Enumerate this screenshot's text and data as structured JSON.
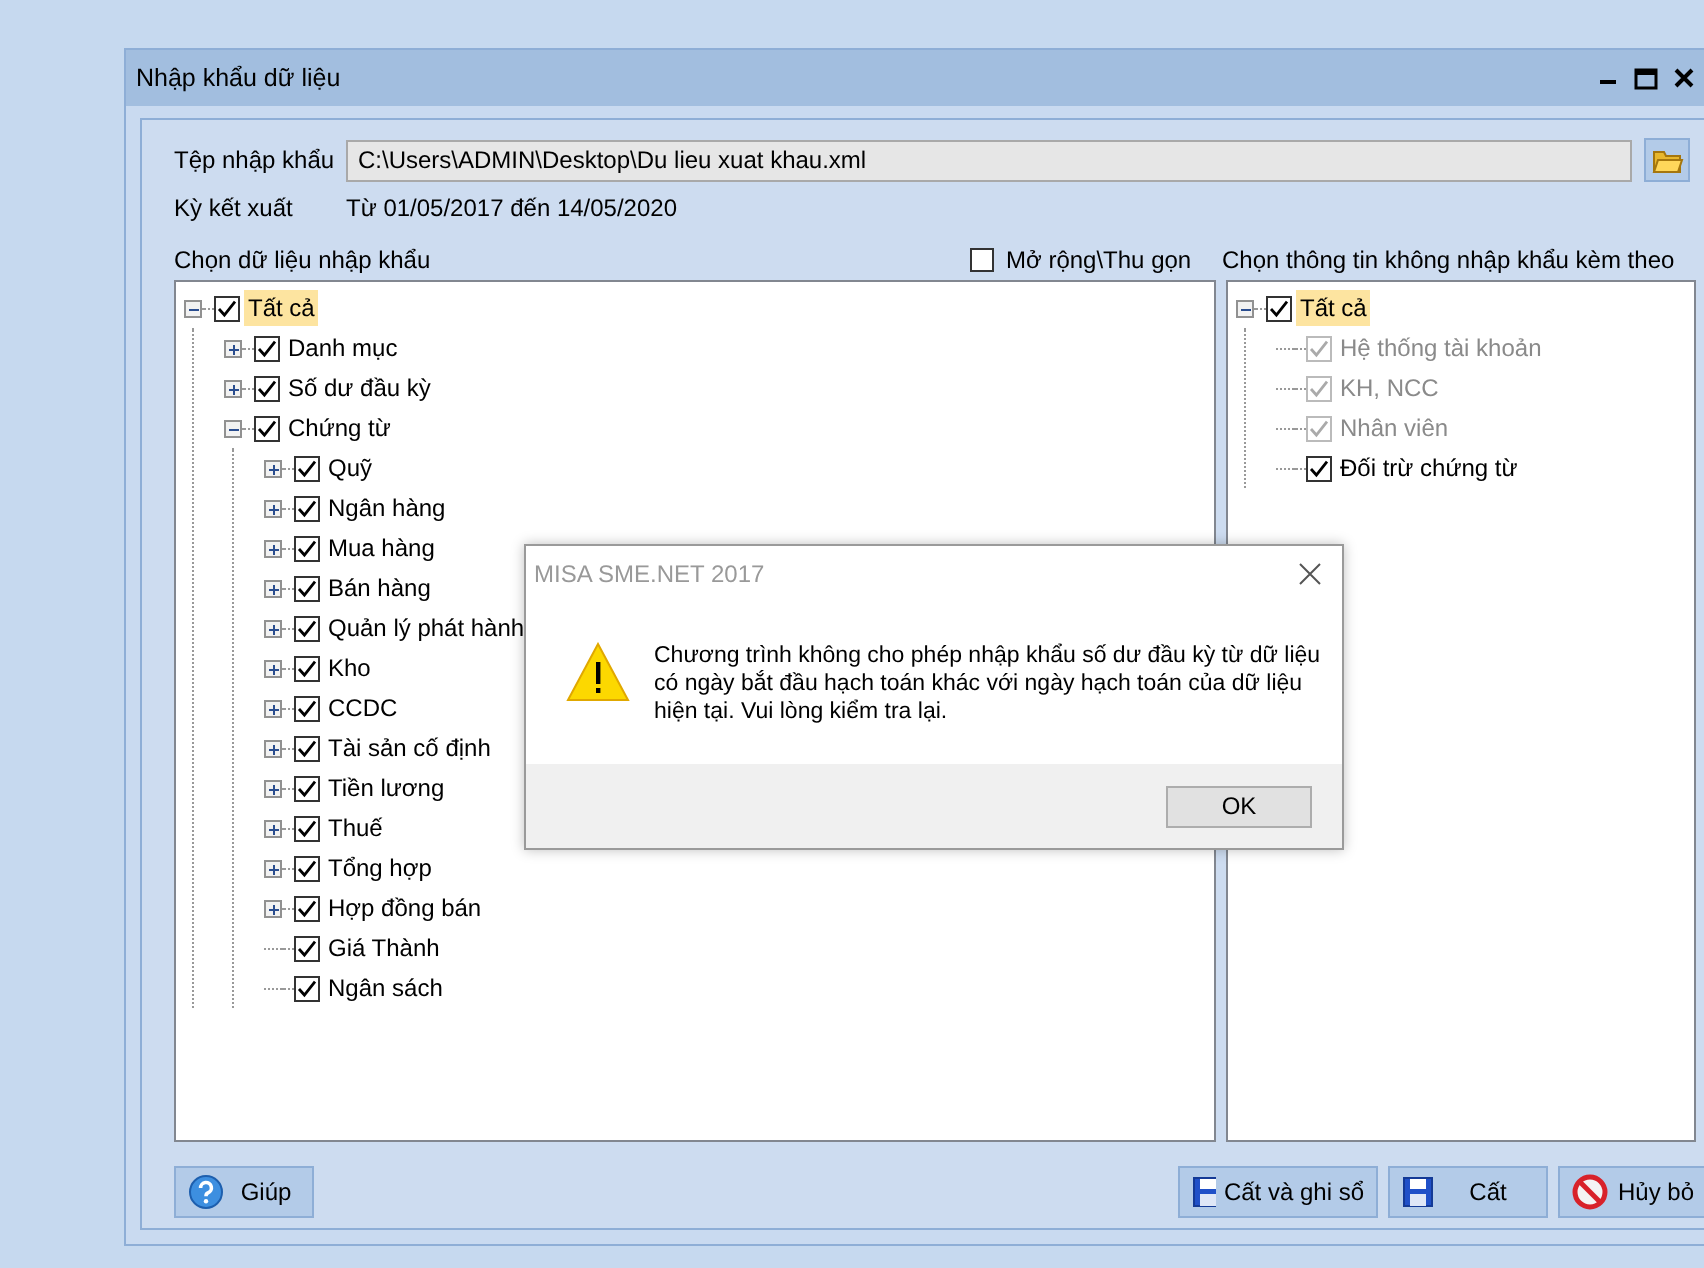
{
  "window": {
    "title": "Nhập khẩu dữ liệu"
  },
  "file_field": {
    "label": "Tệp nhập khẩu",
    "value": "C:\\Users\\ADMIN\\Desktop\\Du lieu xuat khau.xml"
  },
  "period": {
    "label": "Kỳ kết xuất",
    "value": "Từ 01/05/2017 đến 14/05/2020"
  },
  "left_panel": {
    "title": "Chọn dữ liệu nhập khẩu",
    "expand_toggle": {
      "label": "Mở rộng\\Thu gọn",
      "checked": false
    },
    "tree": [
      {
        "label": "Tất cả",
        "checked": true,
        "expanded": true,
        "selected": true,
        "disabled": false,
        "children": [
          {
            "label": "Danh mục",
            "checked": true,
            "expanded": false,
            "selected": false,
            "disabled": false
          },
          {
            "label": "Số dư đầu kỳ",
            "checked": true,
            "expanded": false,
            "selected": false,
            "disabled": false
          },
          {
            "label": "Chứng từ",
            "checked": true,
            "expanded": true,
            "selected": false,
            "disabled": false,
            "children": [
              {
                "label": "Quỹ",
                "checked": true,
                "expanded": false,
                "selected": false,
                "disabled": false
              },
              {
                "label": "Ngân hàng",
                "checked": true,
                "expanded": false,
                "selected": false,
                "disabled": false
              },
              {
                "label": "Mua hàng",
                "checked": true,
                "expanded": false,
                "selected": false,
                "disabled": false
              },
              {
                "label": "Bán hàng",
                "checked": true,
                "expanded": false,
                "selected": false,
                "disabled": false
              },
              {
                "label": "Quản lý phát hành",
                "checked": true,
                "expanded": false,
                "selected": false,
                "disabled": false
              },
              {
                "label": "Kho",
                "checked": true,
                "expanded": false,
                "selected": false,
                "disabled": false
              },
              {
                "label": "CCDC",
                "checked": true,
                "expanded": false,
                "selected": false,
                "disabled": false
              },
              {
                "label": "Tài sản cố định",
                "checked": true,
                "expanded": false,
                "selected": false,
                "disabled": false
              },
              {
                "label": "Tiền lương",
                "checked": true,
                "expanded": false,
                "selected": false,
                "disabled": false
              },
              {
                "label": "Thuế",
                "checked": true,
                "expanded": false,
                "selected": false,
                "disabled": false
              },
              {
                "label": "Tổng hợp",
                "checked": true,
                "expanded": false,
                "selected": false,
                "disabled": false
              },
              {
                "label": "Hợp đồng bán",
                "checked": true,
                "expanded": false,
                "selected": false,
                "disabled": false
              },
              {
                "label": "Giá Thành",
                "checked": true,
                "selected": false,
                "disabled": false
              },
              {
                "label": "Ngân sách",
                "checked": true,
                "selected": false,
                "disabled": false
              }
            ]
          }
        ]
      }
    ]
  },
  "right_panel": {
    "title": "Chọn thông tin không nhập khẩu kèm theo",
    "tree": [
      {
        "label": "Tất cả",
        "checked": true,
        "expanded": true,
        "selected": true,
        "disabled": false,
        "children": [
          {
            "label": "Hệ thống tài khoản",
            "checked": true,
            "selected": false,
            "disabled": true
          },
          {
            "label": "KH, NCC",
            "checked": true,
            "selected": false,
            "disabled": true
          },
          {
            "label": "Nhân viên",
            "checked": true,
            "selected": false,
            "disabled": true
          },
          {
            "label": "Đối trừ chứng từ",
            "checked": true,
            "selected": false,
            "disabled": false
          }
        ]
      }
    ]
  },
  "buttons": [
    {
      "label": "Giúp",
      "kind": "help"
    },
    {
      "label": "Cất và ghi sổ",
      "kind": "save"
    },
    {
      "label": "Cất",
      "kind": "save"
    },
    {
      "label": "Hủy bỏ",
      "kind": "cancel"
    }
  ],
  "dialog": {
    "title": "MISA SME.NET 2017",
    "message": "Chương trình không cho phép nhập khẩu số dư đầu kỳ từ dữ liệu có ngày bắt đầu hạch toán khác với ngày hạch toán của dữ liệu hiện tại. Vui lòng kiểm tra lại.",
    "button": "OK"
  }
}
